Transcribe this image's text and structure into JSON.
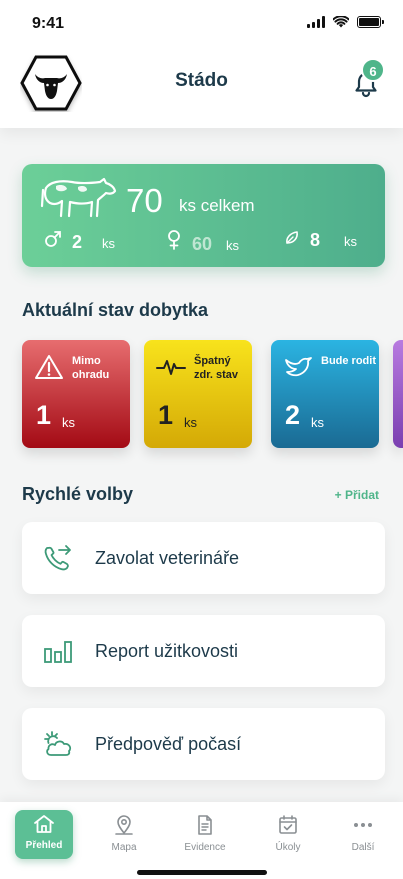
{
  "status_bar": {
    "time": "9:41"
  },
  "header": {
    "title": "Stádo",
    "notifications_count": "6"
  },
  "summary": {
    "total": "70",
    "total_label": "ks celkem",
    "male": "2",
    "female": "60",
    "calf": "8",
    "unit": "ks"
  },
  "herd_status": {
    "title": "Aktuální stav dobytka",
    "cards": [
      {
        "label": "Mimo ohradu",
        "count": "1",
        "unit": "ks",
        "icon": "warning-icon",
        "color": "#c62a30"
      },
      {
        "label": "Špatný zdr. stav",
        "count": "1",
        "unit": "ks",
        "icon": "heartbeat-icon",
        "color": "#f0c90f"
      },
      {
        "label": "Bude rodit",
        "count": "2",
        "unit": "ks",
        "icon": "bird-icon",
        "color": "#238ebd"
      }
    ]
  },
  "quick_actions": {
    "title": "Rychlé volby",
    "add_label": "+ Přidat",
    "items": [
      {
        "label": "Zavolat veterináře",
        "icon": "phone-icon"
      },
      {
        "label": "Report užitkovosti",
        "icon": "bar-chart-icon"
      },
      {
        "label": "Předpověď počasí",
        "icon": "weather-icon"
      }
    ]
  },
  "nav": {
    "items": [
      {
        "label": "Přehled",
        "icon": "home-icon",
        "active": true
      },
      {
        "label": "Mapa",
        "icon": "map-pin-icon"
      },
      {
        "label": "Evidence",
        "icon": "document-icon"
      },
      {
        "label": "Úkoly",
        "icon": "calendar-check-icon"
      },
      {
        "label": "Další",
        "icon": "more-icon"
      }
    ]
  },
  "colors": {
    "accent": "#4fb58a",
    "text": "#1d3a4a"
  }
}
